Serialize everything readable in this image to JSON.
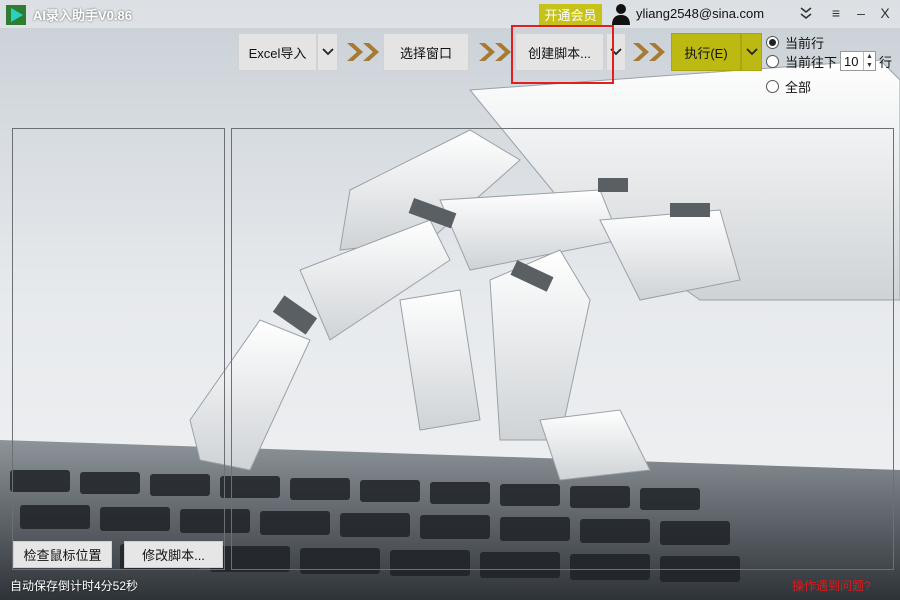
{
  "app": {
    "title": "AI录入助手V0.86",
    "vip_label": "开通会员",
    "user_email": "yliang2548@sina.com",
    "controls": {
      "menu": "≡",
      "minimize": "–",
      "close": "X"
    }
  },
  "toolbar": {
    "excel_import": "Excel导入",
    "select_window": "选择窗口",
    "create_script": "创建脚本...",
    "execute": "执行(E)"
  },
  "options": {
    "current_row": "当前行",
    "current_down": "当前往下",
    "rows_value": "10",
    "rows_unit": "行",
    "all": "全部",
    "selected": "current_row"
  },
  "bottom": {
    "check_mouse": "检查鼠标位置",
    "edit_script": "修改脚本..."
  },
  "status": {
    "autosave": "自动保存倒计时4分52秒",
    "help": "操作遇到问题?"
  },
  "colors": {
    "accent": "#bcb913",
    "highlight": "#e02020",
    "arrow": "#a77a31",
    "help": "#e01818"
  }
}
